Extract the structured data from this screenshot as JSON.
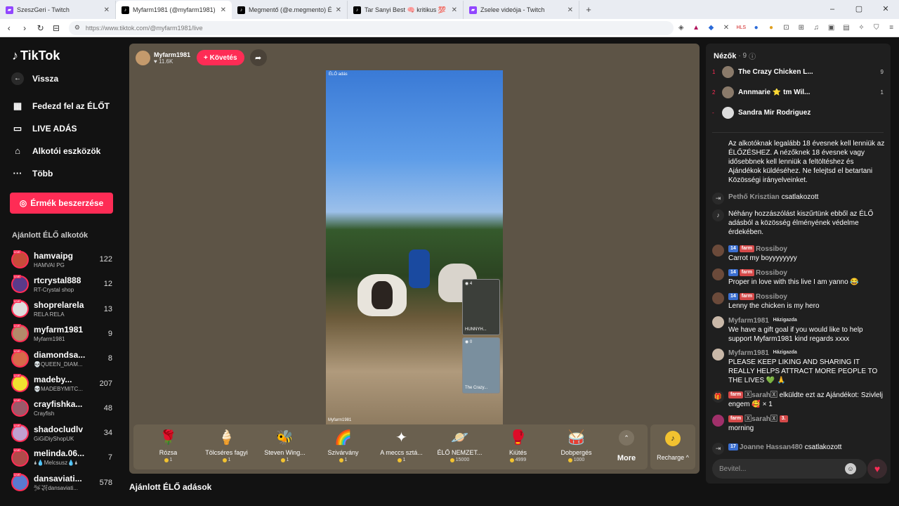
{
  "browser": {
    "tabs": [
      {
        "title": "SzeszGeri - Twitch",
        "fav": "twitch-icon",
        "color": "#9146ff"
      },
      {
        "title": "Myfarm1981 (@myfarm1981) ÉL",
        "fav": "tiktok-icon",
        "color": "#000000"
      },
      {
        "title": "Megmentő (@e.megmento) ÉLŐ adá",
        "fav": "tiktok-icon",
        "color": "#000000"
      },
      {
        "title": "Tar Sanyi Best 🧠 kritikus 💯 (@szop",
        "fav": "tiktok-icon",
        "color": "#000000"
      },
      {
        "title": "Zselee videója - Twitch",
        "fav": "twitch-icon",
        "color": "#9146ff"
      }
    ],
    "url": "https://www.tiktok.com/@myfarm1981/live"
  },
  "sidebar": {
    "logo": "TikTok",
    "back": "Vissza",
    "nav": [
      {
        "label": "Fedezd fel az ÉLŐT",
        "icon": "calendar-live-icon",
        "glyph": "▦"
      },
      {
        "label": "LIVE ADÁS",
        "icon": "camera-icon",
        "glyph": "▭"
      },
      {
        "label": "Alkotói eszközök",
        "icon": "house-icon",
        "glyph": "⌂"
      },
      {
        "label": "Több",
        "icon": "more-icon",
        "glyph": "···"
      }
    ],
    "coins_button": "Érmék beszerzése",
    "recommended_title": "Ajánlott ÉLŐ alkotók",
    "creators": [
      {
        "name": "hamvaipg",
        "sub": "HAMVAI PG",
        "count": "122",
        "color": "#c74b3a"
      },
      {
        "name": "rtcrystal888",
        "sub": "RT-Crystal shop",
        "count": "12",
        "color": "#5a3a8a"
      },
      {
        "name": "shoprelarela",
        "sub": "RELA RELA",
        "count": "13",
        "color": "#ddd"
      },
      {
        "name": "myfarm1981",
        "sub": "Myfarm1981",
        "count": "9",
        "color": "#b38a6a"
      },
      {
        "name": "diamondsa...",
        "sub": "💀QUEEN_DIAM...",
        "count": "8",
        "color": "#d76a4a"
      },
      {
        "name": "madeby...",
        "sub": "💀MADEBYMITC...",
        "count": "207",
        "color": "#f0e030"
      },
      {
        "name": "crayfishka...",
        "sub": "Crayfish",
        "count": "48",
        "color": "#9a5a6a"
      },
      {
        "name": "shadocludlv",
        "sub": "GiGiDiyShopUK",
        "count": "34",
        "color": "#c0a0d0"
      },
      {
        "name": "melinda.06...",
        "sub": "🌢💧Melcsusz💧🌢",
        "count": "7",
        "color": "#b04a4a"
      },
      {
        "name": "dansaviati...",
        "sub": "🛩✈dansaviati...",
        "count": "578",
        "color": "#5a7ad0"
      }
    ]
  },
  "stream": {
    "host_name": "Myfarm1981",
    "host_likes": "♥ 11.6K",
    "follow": "+ Követés",
    "video_top_label": "ÉLŐ adás",
    "video_bottom_label": "Myfarm1981",
    "pip1": {
      "count": "◉ 4",
      "name": "HUNNYH..."
    },
    "pip2": {
      "count": "◉ 0",
      "name": "The Crazy..."
    }
  },
  "gifts": [
    {
      "name": "Rózsa",
      "price": "1",
      "icon": "rose-icon",
      "glyph": "🌹"
    },
    {
      "name": "Tölcséres fagyi",
      "price": "1",
      "icon": "ice-cream-icon",
      "glyph": "🍦"
    },
    {
      "name": "Steven Wing...",
      "price": "1",
      "icon": "bee-icon",
      "glyph": "🐝"
    },
    {
      "name": "Szivárvány",
      "price": "1",
      "icon": "rainbow-icon",
      "glyph": "🌈"
    },
    {
      "name": "A meccs sztá...",
      "price": "1",
      "icon": "star-icon",
      "glyph": "✦"
    },
    {
      "name": "ÉLŐ NEMZET...",
      "price": "15000",
      "icon": "planet-icon",
      "glyph": "🪐"
    },
    {
      "name": "Kiütés",
      "price": "4999",
      "icon": "knockout-icon",
      "glyph": "🥊"
    },
    {
      "name": "Dobpergés",
      "price": "1000",
      "icon": "drum-icon",
      "glyph": "🥁"
    }
  ],
  "more_label": "More",
  "recharge_label": "Recharge ^",
  "suggested_title": "Ajánlott ÉLŐ adások",
  "chat": {
    "viewers_title": "Nézők",
    "viewers_count": "· 9",
    "viewers": [
      {
        "rank": "1",
        "name": "The Crazy Chicken L...",
        "count": "9"
      },
      {
        "rank": "2",
        "name": "Annmarie ⭐ tm Wil...",
        "count": "1"
      },
      {
        "rank": "-",
        "name": "Sandra Mir Rodriguez",
        "count": ""
      }
    ],
    "messages": [
      {
        "type": "system",
        "user": "",
        "text": "Az alkotóknak legalább 18 évesnek kell lenniük az ÉLŐZÉSHEZ. A nézőknek 18 évesnek vagy idősebbnek kell lenniük a feltöltéshez és Ajándékok küldéséhez. Ne felejtsd el betartani Közösségi irányelveinket."
      },
      {
        "type": "join",
        "user": "Pethő Krisztian",
        "text": "csatlakozott"
      },
      {
        "type": "system",
        "user": "",
        "text": "Néhány hozzászólást kiszűrtünk ebből az ÉLŐ adásból a közösség élményének védelme érdekében."
      },
      {
        "type": "user",
        "lvl": "14",
        "fan": "farm",
        "user": "Rossiboy",
        "text": "Carrot my boyyyyyyyy"
      },
      {
        "type": "user",
        "lvl": "14",
        "fan": "farm",
        "user": "Rossiboy",
        "text": "Proper in love with this live I am yanno 😂"
      },
      {
        "type": "user",
        "lvl": "14",
        "fan": "farm",
        "user": "Rossiboy",
        "text": "Lenny the chicken is my hero"
      },
      {
        "type": "host",
        "user": "Myfarm1981",
        "host": "Házigazda",
        "text": "We have a gift goal if you would like to help support Myfarm1981 kind regards xxxx"
      },
      {
        "type": "host",
        "user": "Myfarm1981",
        "host": "Házigazda",
        "text": "PLEASE KEEP LIKING AND SHARING IT REALLY HELPS ATTRACT MORE PEOPLE TO THE LIVES 💚 🙏"
      },
      {
        "type": "gift",
        "fan": "farm",
        "user": "🅇sarah🅇",
        "text": "elküldte ezt az Ajándékot: Szivlelj engem 🥰 × 1"
      },
      {
        "type": "user2",
        "fan": "farm",
        "user": "🅇sarah🅇",
        "badge": "3.",
        "text": "morning"
      },
      {
        "type": "join",
        "lvl": "17",
        "user": "Joanne Hassan480",
        "text": "csatlakozott"
      }
    ],
    "input_placeholder": "Bevitel..."
  }
}
